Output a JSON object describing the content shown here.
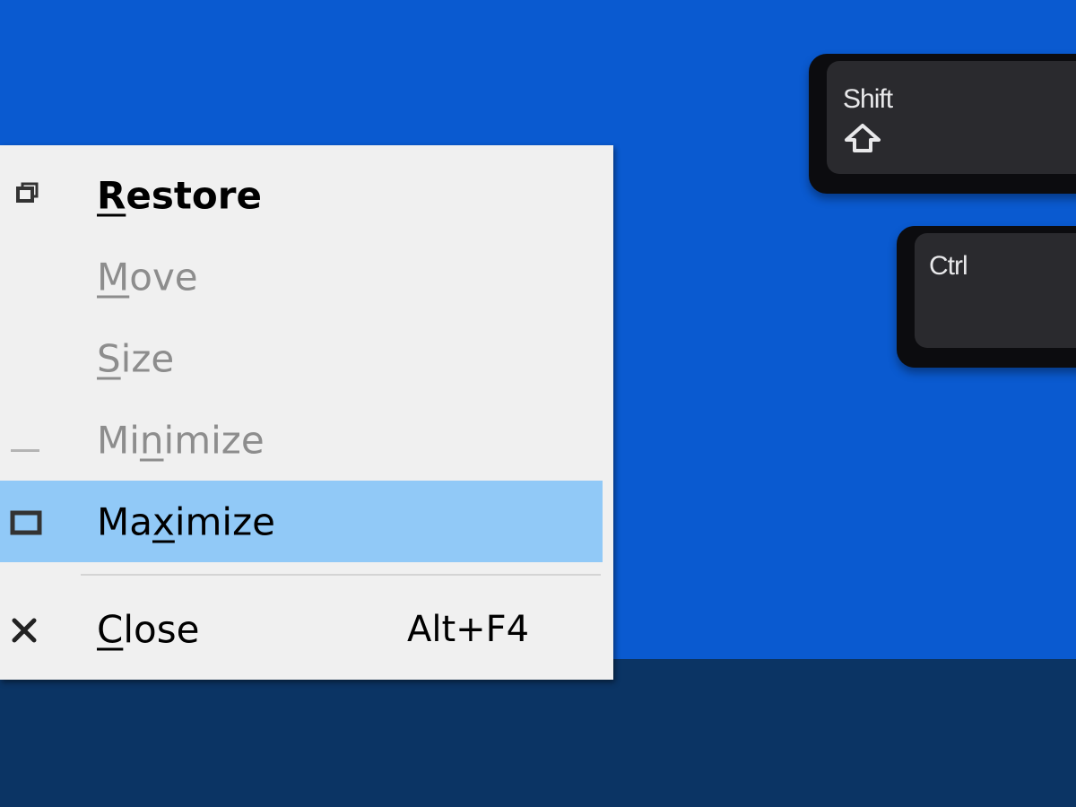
{
  "keyboard": {
    "shift_label": "Shift",
    "ctrl_label": "Ctrl"
  },
  "system_menu": {
    "items": [
      {
        "name": "restore",
        "pre": "",
        "accel": "R",
        "post": "estore",
        "state": "enabled-default",
        "icon": "restore-icon"
      },
      {
        "name": "move",
        "pre": "",
        "accel": "M",
        "post": "ove",
        "state": "disabled",
        "icon": ""
      },
      {
        "name": "size",
        "pre": "",
        "accel": "S",
        "post": "ize",
        "state": "disabled",
        "icon": ""
      },
      {
        "name": "minimize",
        "pre": "Mi",
        "accel": "n",
        "post": "imize",
        "state": "disabled",
        "icon": "minimize-icon"
      },
      {
        "name": "maximize",
        "pre": "Ma",
        "accel": "x",
        "post": "imize",
        "state": "highlighted",
        "icon": "maximize-icon"
      },
      {
        "name": "close",
        "pre": "",
        "accel": "C",
        "post": "lose",
        "state": "enabled",
        "icon": "close-icon",
        "shortcut": "Alt+F4"
      }
    ]
  },
  "colors": {
    "desktop": "#0a5ad0",
    "taskbar": "#0b3464",
    "menu_background": "#f0f0f0",
    "highlight": "#91c9f7",
    "disabled_text": "#8d8d8d"
  }
}
